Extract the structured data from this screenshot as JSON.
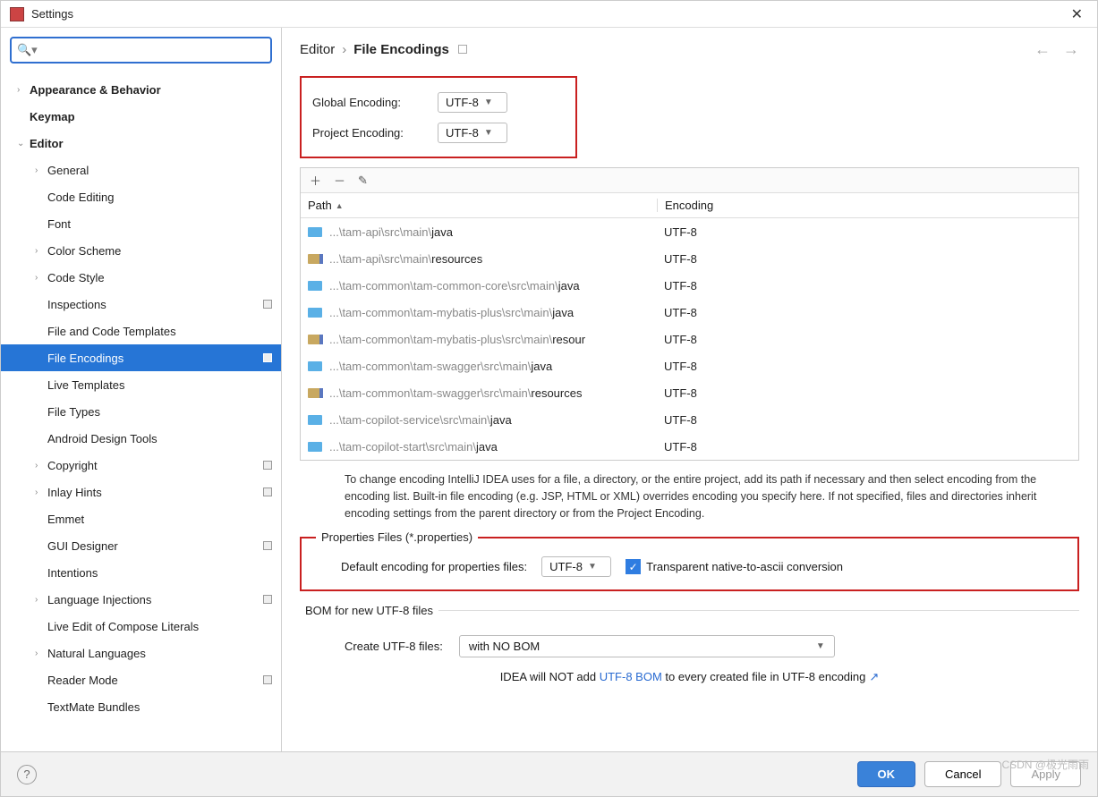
{
  "window_title": "Settings",
  "sidebar": {
    "search_placeholder": "",
    "items": [
      {
        "label": "Appearance & Behavior",
        "level": 0,
        "chev": ">",
        "bold": true
      },
      {
        "label": "Keymap",
        "level": 0,
        "chev": "",
        "bold": true
      },
      {
        "label": "Editor",
        "level": 0,
        "chev": "v",
        "bold": true
      },
      {
        "label": "General",
        "level": 1,
        "chev": ">"
      },
      {
        "label": "Code Editing",
        "level": 1,
        "chev": ""
      },
      {
        "label": "Font",
        "level": 1,
        "chev": ""
      },
      {
        "label": "Color Scheme",
        "level": 1,
        "chev": ">"
      },
      {
        "label": "Code Style",
        "level": 1,
        "chev": ">"
      },
      {
        "label": "Inspections",
        "level": 1,
        "chev": "",
        "marker": true
      },
      {
        "label": "File and Code Templates",
        "level": 1,
        "chev": ""
      },
      {
        "label": "File Encodings",
        "level": 1,
        "chev": "",
        "marker": true,
        "selected": true
      },
      {
        "label": "Live Templates",
        "level": 1,
        "chev": ""
      },
      {
        "label": "File Types",
        "level": 1,
        "chev": ""
      },
      {
        "label": "Android Design Tools",
        "level": 1,
        "chev": ""
      },
      {
        "label": "Copyright",
        "level": 1,
        "chev": ">",
        "marker": true
      },
      {
        "label": "Inlay Hints",
        "level": 1,
        "chev": ">",
        "marker": true
      },
      {
        "label": "Emmet",
        "level": 1,
        "chev": ""
      },
      {
        "label": "GUI Designer",
        "level": 1,
        "chev": "",
        "marker": true
      },
      {
        "label": "Intentions",
        "level": 1,
        "chev": ""
      },
      {
        "label": "Language Injections",
        "level": 1,
        "chev": ">",
        "marker": true
      },
      {
        "label": "Live Edit of Compose Literals",
        "level": 1,
        "chev": ""
      },
      {
        "label": "Natural Languages",
        "level": 1,
        "chev": ">"
      },
      {
        "label": "Reader Mode",
        "level": 1,
        "chev": "",
        "marker": true
      },
      {
        "label": "TextMate Bundles",
        "level": 1,
        "chev": ""
      }
    ]
  },
  "breadcrumb": {
    "parent": "Editor",
    "current": "File Encodings"
  },
  "encodings": {
    "global_label": "Global Encoding:",
    "global_value": "UTF-8",
    "project_label": "Project Encoding:",
    "project_value": "UTF-8"
  },
  "path_table": {
    "col_path": "Path",
    "col_enc": "Encoding",
    "rows": [
      {
        "icon": "blue",
        "prefix": "...\\tam-api\\src\\main\\",
        "name": "java",
        "enc": "UTF-8"
      },
      {
        "icon": "yellow",
        "prefix": "...\\tam-api\\src\\main\\",
        "name": "resources",
        "enc": "UTF-8"
      },
      {
        "icon": "blue",
        "prefix": "...\\tam-common\\tam-common-core\\src\\main\\",
        "name": "java",
        "enc": "UTF-8"
      },
      {
        "icon": "blue",
        "prefix": "...\\tam-common\\tam-mybatis-plus\\src\\main\\",
        "name": "java",
        "enc": "UTF-8"
      },
      {
        "icon": "yellow",
        "prefix": "...\\tam-common\\tam-mybatis-plus\\src\\main\\",
        "name": "resour",
        "enc": "UTF-8"
      },
      {
        "icon": "blue",
        "prefix": "...\\tam-common\\tam-swagger\\src\\main\\",
        "name": "java",
        "enc": "UTF-8"
      },
      {
        "icon": "yellow",
        "prefix": "...\\tam-common\\tam-swagger\\src\\main\\",
        "name": "resources",
        "enc": "UTF-8"
      },
      {
        "icon": "blue",
        "prefix": "...\\tam-copilot-service\\src\\main\\",
        "name": "java",
        "enc": "UTF-8"
      },
      {
        "icon": "blue",
        "prefix": "...\\tam-copilot-start\\src\\main\\",
        "name": "java",
        "enc": "UTF-8"
      }
    ]
  },
  "description": "To change encoding IntelliJ IDEA uses for a file, a directory, or the entire project, add its path if necessary and then select encoding from the encoding list. Built-in file encoding (e.g. JSP, HTML or XML) overrides encoding you specify here. If not specified, files and directories inherit encoding settings from the parent directory or from the Project Encoding.",
  "properties": {
    "legend": "Properties Files (*.properties)",
    "default_label": "Default encoding for properties files:",
    "default_value": "UTF-8",
    "checkbox_label": "Transparent native-to-ascii conversion",
    "checkbox_checked": true
  },
  "bom": {
    "legend": "BOM for new UTF-8 files",
    "label": "Create UTF-8 files:",
    "value": "with NO BOM",
    "note_pre": "IDEA will NOT add ",
    "note_link": "UTF-8 BOM",
    "note_post": " to every created file in UTF-8 encoding"
  },
  "footer": {
    "ok": "OK",
    "cancel": "Cancel",
    "apply": "Apply"
  },
  "watermark": "CSDN @极光雨雨"
}
